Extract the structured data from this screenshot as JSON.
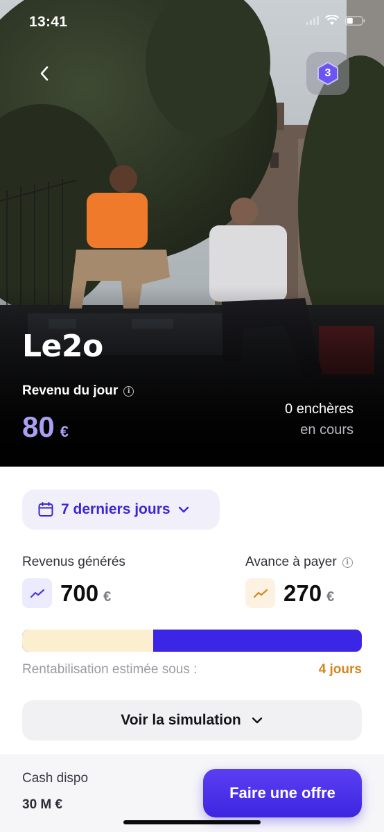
{
  "status_bar": {
    "time": "13:41"
  },
  "hero": {
    "level": "3",
    "artist_name": "Le2o",
    "daily_revenue_label": "Revenu du jour",
    "daily_revenue_value": "80",
    "currency": "€",
    "auctions_count": "0 enchères",
    "auctions_status": "en cours"
  },
  "period": {
    "label": "7 derniers jours"
  },
  "stats": {
    "revenue_label": "Revenus générés",
    "revenue_value": "700",
    "revenue_currency": "€",
    "advance_label": "Avance à payer",
    "advance_value": "270",
    "advance_currency": "€"
  },
  "breakeven": {
    "progress_fraction": 0.385,
    "label": "Rentabilisation estimée sous :",
    "value": "4 jours"
  },
  "simulation": {
    "label": "Voir la simulation"
  },
  "footer": {
    "cash_label": "Cash dispo",
    "cash_value": "30 M €",
    "offer_button": "Faire une offre"
  },
  "colors": {
    "accent": "#3c26e6",
    "accent_light": "#a9a0f4",
    "warning": "#d5861f",
    "progress_fill": "#fcefcf"
  },
  "icons": [
    "chevron-left-icon",
    "hexagon-level-icon",
    "info-icon",
    "calendar-icon",
    "chevron-down-icon",
    "trend-up-icon",
    "signal-icon",
    "wifi-icon",
    "battery-icon"
  ]
}
